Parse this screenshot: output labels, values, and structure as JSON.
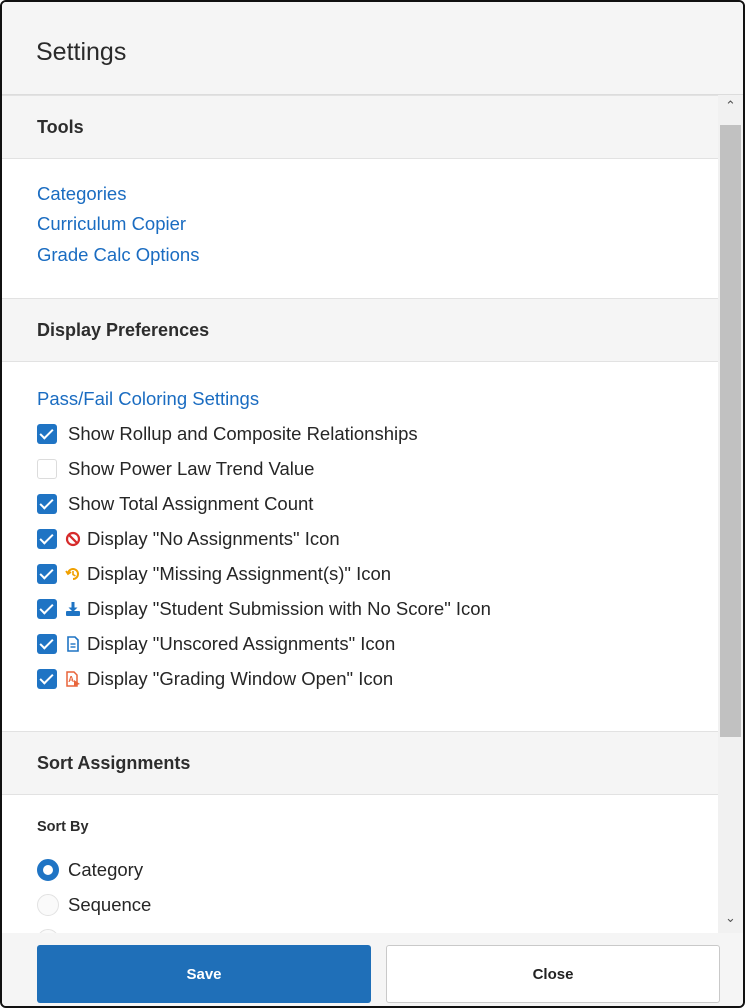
{
  "dialog": {
    "title": "Settings"
  },
  "tools": {
    "header": "Tools",
    "links": [
      "Categories",
      "Curriculum Copier",
      "Grade Calc Options"
    ]
  },
  "display_preferences": {
    "header": "Display Preferences",
    "link": "Pass/Fail Coloring Settings",
    "options": [
      {
        "label": "Show Rollup and Composite Relationships",
        "checked": true,
        "icon": ""
      },
      {
        "label": "Show Power Law Trend Value",
        "checked": false,
        "icon": ""
      },
      {
        "label": "Show Total Assignment Count",
        "checked": true,
        "icon": ""
      },
      {
        "label": "Display \"No Assignments\" Icon",
        "checked": true,
        "icon": "no-assignments-icon"
      },
      {
        "label": "Display \"Missing Assignment(s)\" Icon",
        "checked": true,
        "icon": "missing-assignment-icon"
      },
      {
        "label": "Display \"Student Submission with No Score\" Icon",
        "checked": true,
        "icon": "submission-download-icon"
      },
      {
        "label": "Display \"Unscored Assignments\" Icon",
        "checked": true,
        "icon": "unscored-document-icon"
      },
      {
        "label": "Display \"Grading Window Open\" Icon",
        "checked": true,
        "icon": "grading-window-icon"
      }
    ]
  },
  "sort_assignments": {
    "header": "Sort Assignments",
    "sort_by_label": "Sort By",
    "options": [
      {
        "label": "Category",
        "selected": true
      },
      {
        "label": "Sequence",
        "selected": false
      }
    ]
  },
  "footer": {
    "save_label": "Save",
    "close_label": "Close"
  },
  "colors": {
    "accent": "#1f74c4",
    "link": "#1a6cc1",
    "no_assign": "#d62b2b",
    "missing": "#f0a000",
    "grading": "#e8643a"
  }
}
